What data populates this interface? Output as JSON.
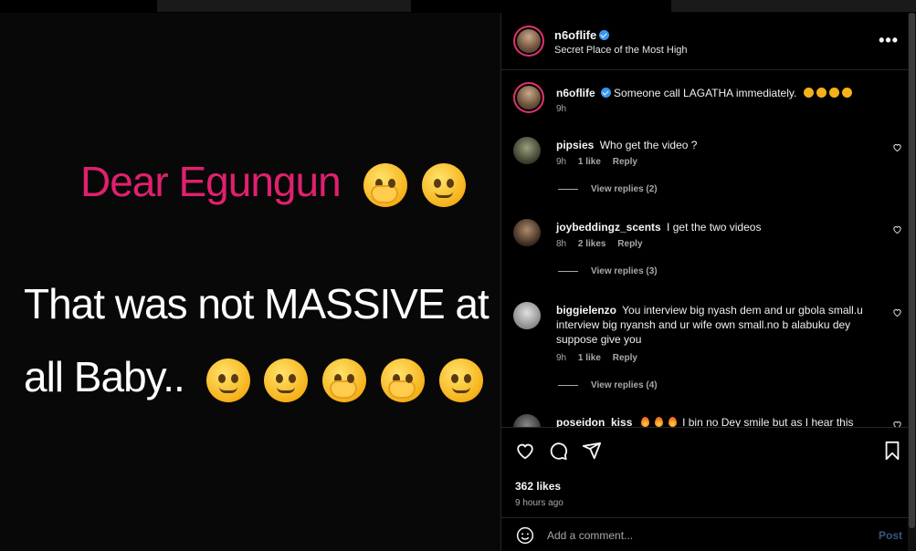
{
  "post": {
    "line1": "Dear Egungun",
    "line2": "That was not MASSIVE at",
    "line3": "all Baby.."
  },
  "header": {
    "username": "n6oflife",
    "subtitle": "Secret Place of the Most High",
    "more": "•••"
  },
  "caption": {
    "username": "n6oflife",
    "text": "Someone call LAGATHA immediately.",
    "time": "9h"
  },
  "comments": [
    {
      "username": "pipsies",
      "text": "Who get the video ?",
      "time": "9h",
      "likes": "1 like",
      "reply": "Reply",
      "view_replies": "View replies (2)"
    },
    {
      "username": "joybeddingz_scents",
      "text": "I get the two videos",
      "time": "8h",
      "likes": "2 likes",
      "reply": "Reply",
      "view_replies": "View replies (3)"
    },
    {
      "username": "biggielenzo",
      "text": "You interview big nyash dem and ur gbola small.u interview big nyansh and ur wife own small.no b alabuku dey suppose give you",
      "time": "9h",
      "likes": "1 like",
      "reply": "Reply",
      "view_replies": "View replies (4)"
    },
    {
      "username": "poseidon_kiss",
      "text": "I bin no Dey smile but as I hear this"
    }
  ],
  "stats": {
    "likes": "362 likes",
    "ago": "9 hours ago"
  },
  "add_comment": {
    "placeholder": "Add a comment...",
    "post": "Post"
  },
  "colors": {
    "accent_pink": "#e0206e",
    "verified_blue": "#3897f0",
    "post_button": "#365880"
  }
}
